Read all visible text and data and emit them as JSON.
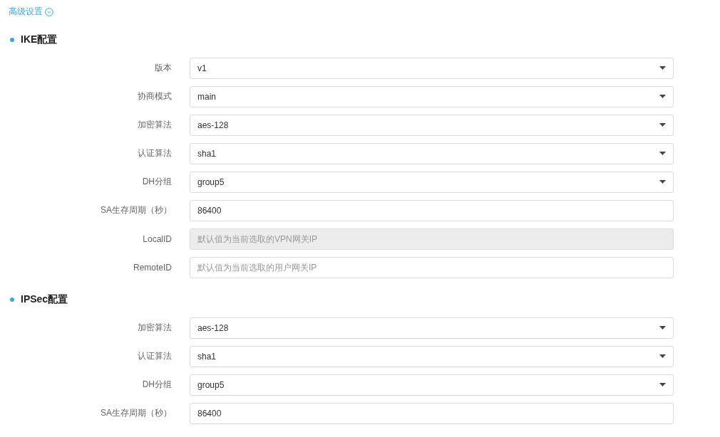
{
  "advanced_toggle": {
    "label": "高级设置",
    "expanded": true
  },
  "sections": [
    {
      "title": "IKE配置",
      "fields": [
        {
          "label": "版本",
          "kind": "select",
          "value": "v1"
        },
        {
          "label": "协商模式",
          "kind": "select",
          "value": "main"
        },
        {
          "label": "加密算法",
          "kind": "select",
          "value": "aes-128"
        },
        {
          "label": "认证算法",
          "kind": "select",
          "value": "sha1"
        },
        {
          "label": "DH分组",
          "kind": "select",
          "value": "group5"
        },
        {
          "label": "SA生存周期（秒）",
          "kind": "input",
          "value": "86400",
          "disabled": false
        },
        {
          "label": "LocalID",
          "kind": "input",
          "placeholder": "默认值为当前选取的VPN网关IP",
          "disabled": true
        },
        {
          "label": "RemoteID",
          "kind": "input",
          "placeholder": "默认值为当前选取的用户网关IP",
          "disabled": false
        }
      ]
    },
    {
      "title": "IPSec配置",
      "fields": [
        {
          "label": "加密算法",
          "kind": "select",
          "value": "aes-128"
        },
        {
          "label": "认证算法",
          "kind": "select",
          "value": "sha1"
        },
        {
          "label": "DH分组",
          "kind": "select",
          "value": "group5"
        },
        {
          "label": "SA生存周期（秒）",
          "kind": "input",
          "value": "86400",
          "disabled": false
        }
      ]
    }
  ]
}
